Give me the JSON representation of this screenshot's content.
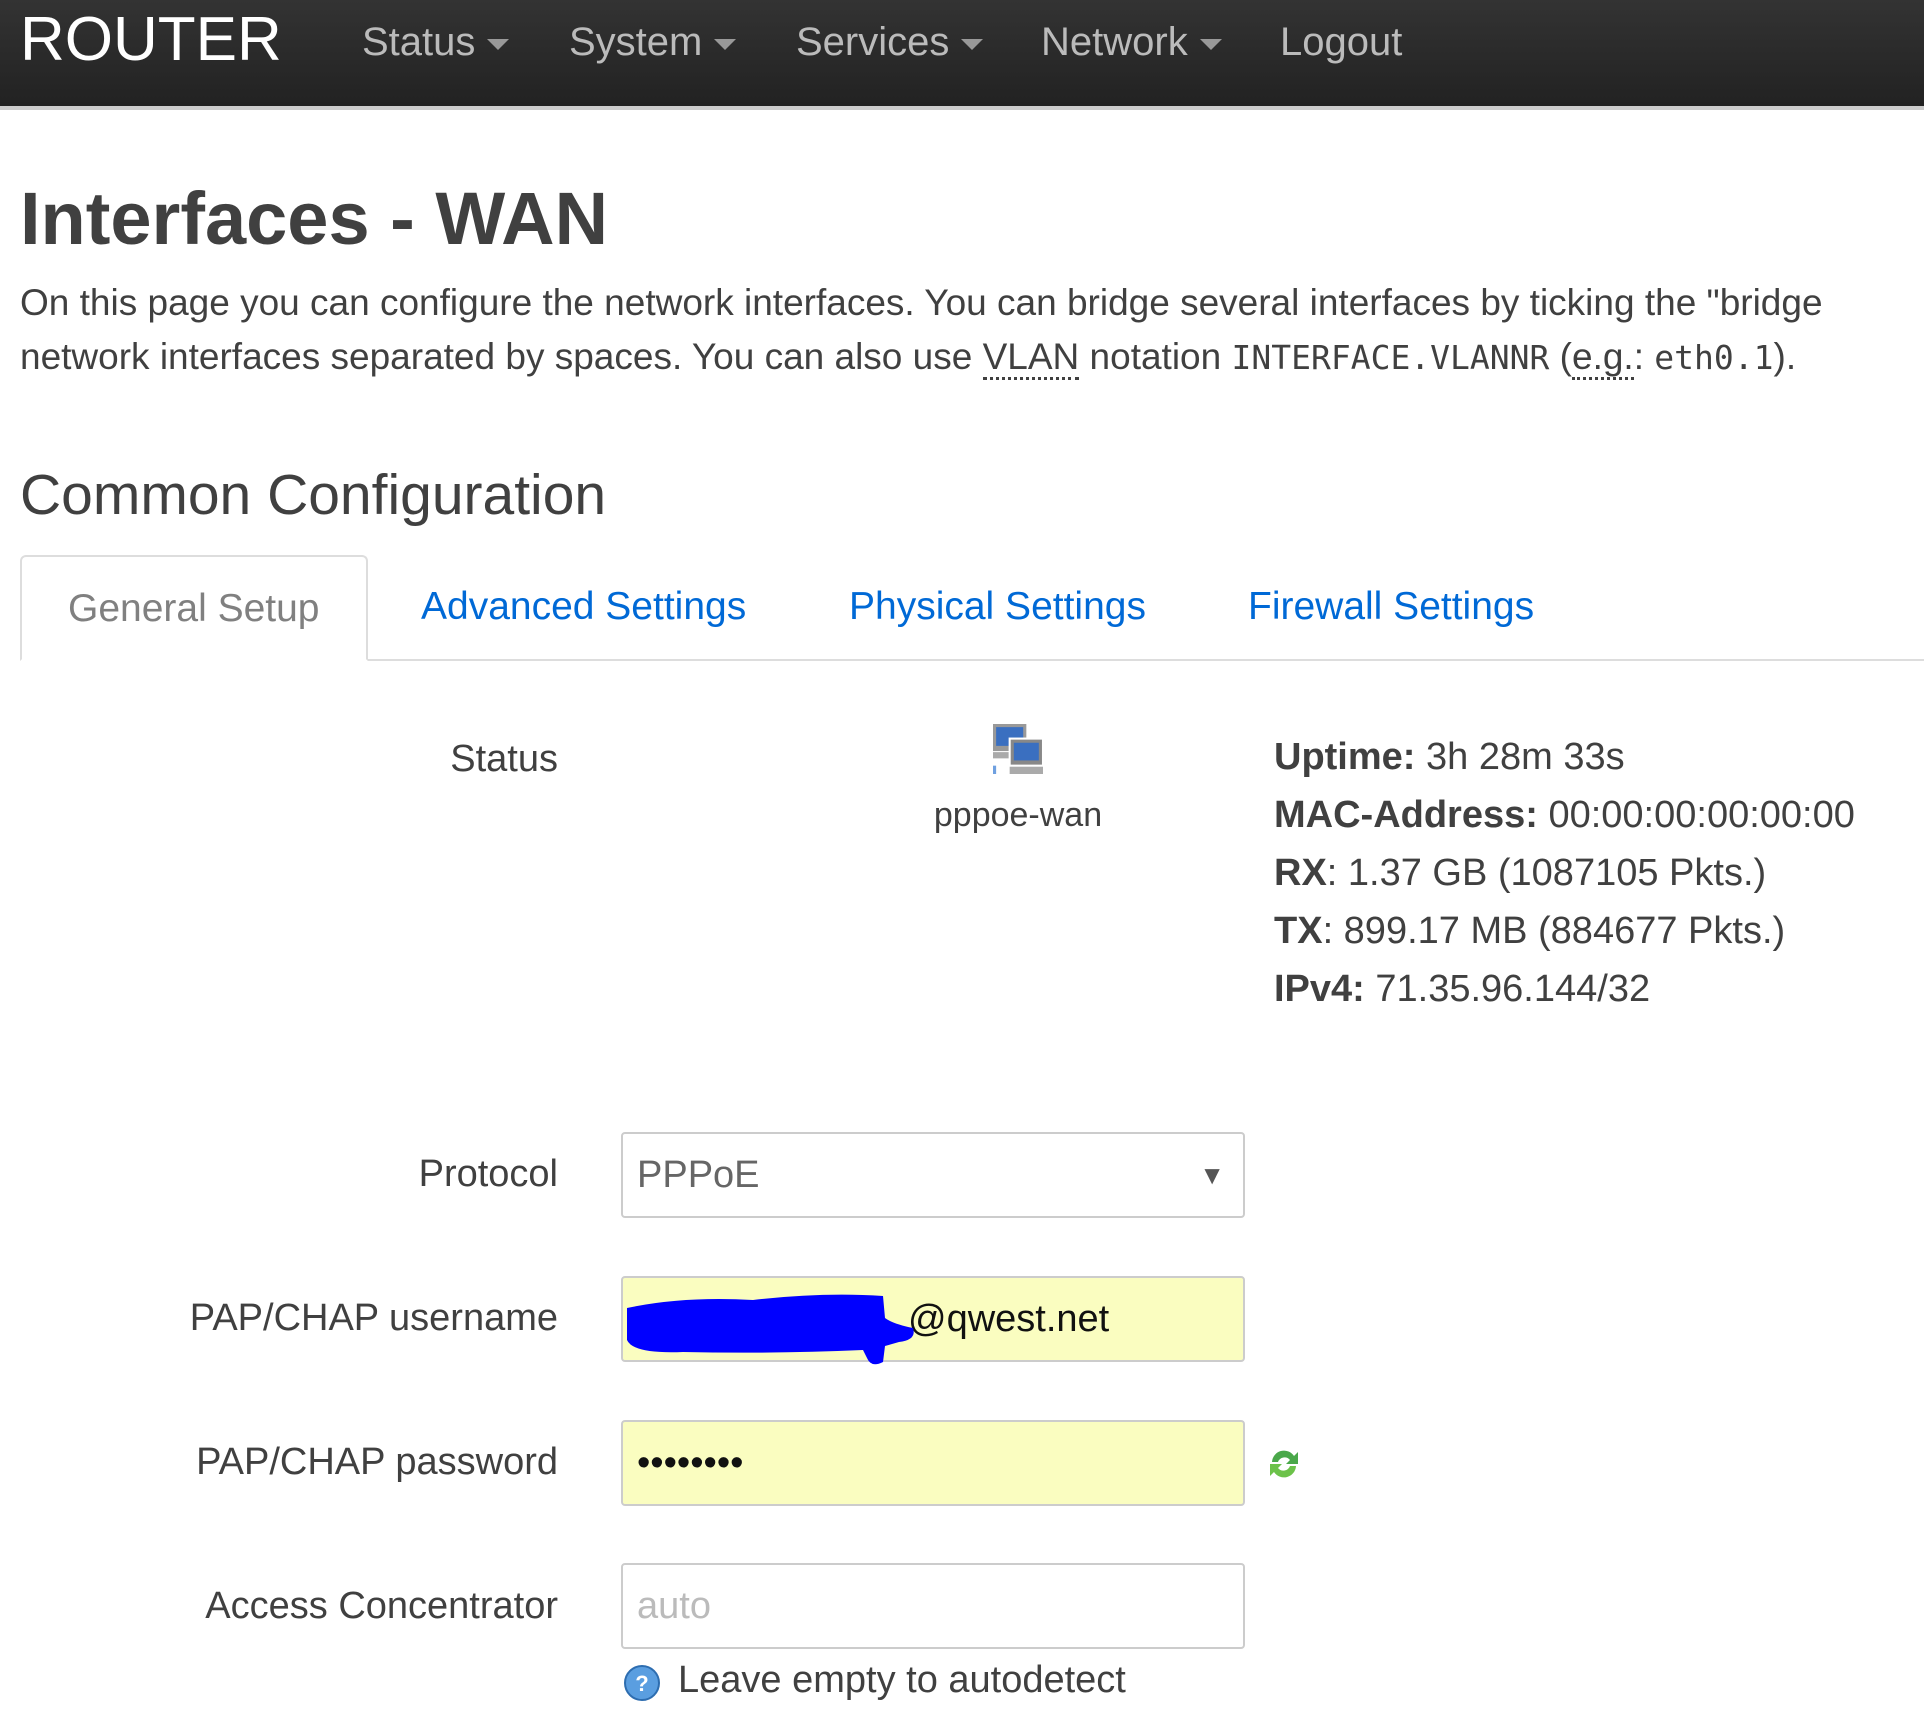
{
  "navbar": {
    "brand": "ROUTER",
    "items": [
      {
        "label": "Status",
        "dropdown": true
      },
      {
        "label": "System",
        "dropdown": true
      },
      {
        "label": "Services",
        "dropdown": true
      },
      {
        "label": "Network",
        "dropdown": true
      },
      {
        "label": "Logout",
        "dropdown": false
      }
    ]
  },
  "page": {
    "title": "Interfaces - WAN",
    "desc_line1": "On this page you can configure the network interfaces. You can bridge several interfaces by ticking the \"bridge",
    "desc_line2_a": "network interfaces separated by spaces. You can also use ",
    "desc_vlan": "VLAN",
    "desc_line2_b": " notation ",
    "desc_code1": "INTERFACE.VLANNR",
    "desc_line2_c": " (",
    "desc_eg": "e.g.",
    "desc_line2_d": ": ",
    "desc_code2": "eth0.1",
    "desc_line2_e": ")."
  },
  "section": {
    "title": "Common Configuration",
    "tabs": [
      {
        "label": "General Setup",
        "active": true
      },
      {
        "label": "Advanced Settings",
        "active": false
      },
      {
        "label": "Physical Settings",
        "active": false
      },
      {
        "label": "Firewall Settings",
        "active": false
      }
    ]
  },
  "status": {
    "label": "Status",
    "icon": "network-interface-icon",
    "interface": "pppoe-wan",
    "uptime_label": "Uptime:",
    "uptime": " 3h 28m 33s",
    "mac_label": "MAC-Address:",
    "mac": " 00:00:00:00:00:00",
    "rx_label": "RX",
    "rx": ": 1.37 GB (1087105 Pkts.)",
    "tx_label": "TX",
    "tx": ": 899.17 MB (884677 Pkts.)",
    "ipv4_label": "IPv4:",
    "ipv4": " 71.35.96.144/32"
  },
  "form": {
    "protocol_label": "Protocol",
    "protocol_value": "PPPoE",
    "username_label": "PAP/CHAP username",
    "username_value": "@qwest.net",
    "password_label": "PAP/CHAP password",
    "password_value": "••••••••",
    "ac_label": "Access Concentrator",
    "ac_placeholder": "auto",
    "ac_help": "Leave empty to autodetect"
  },
  "colors": {
    "navbar": "#222222",
    "link": "#0069d6",
    "autofill": "#fafdc0",
    "redaction": "#0000ff"
  }
}
